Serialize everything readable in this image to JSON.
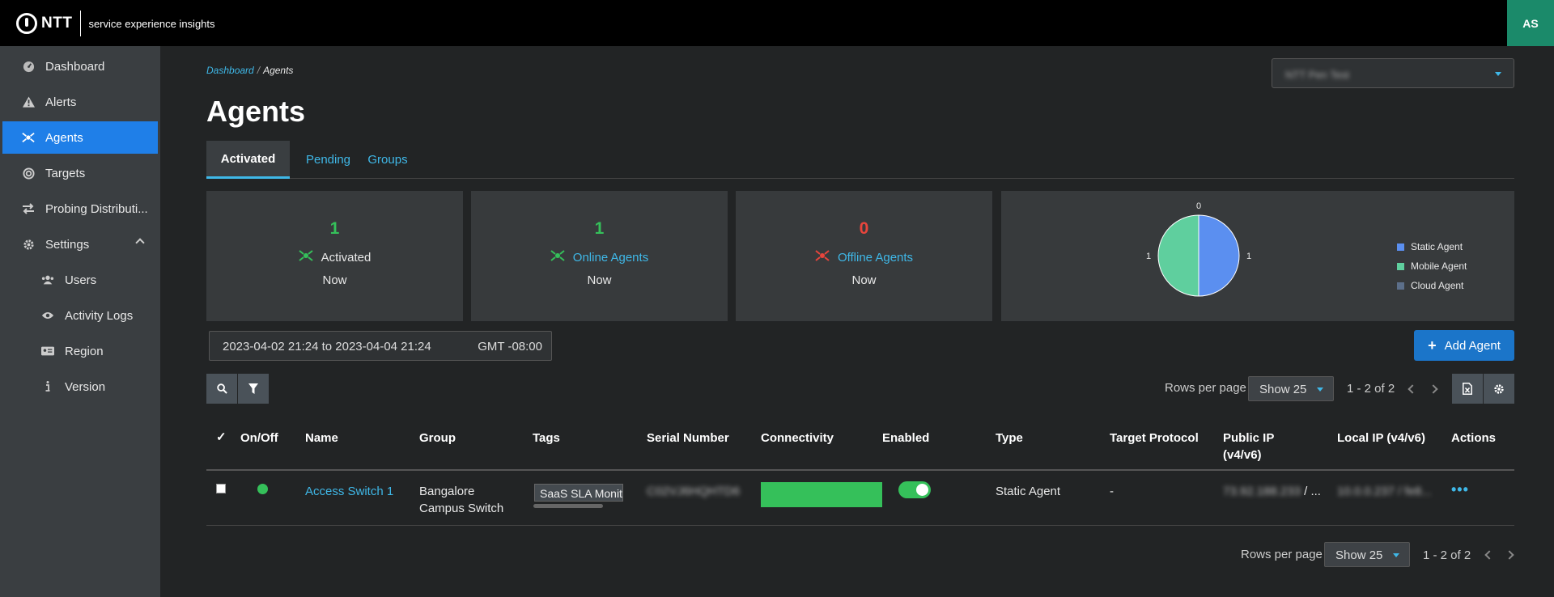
{
  "brand": {
    "name": "NTT",
    "product": "service experience insights"
  },
  "user": {
    "initials": "AS"
  },
  "sidebar": {
    "items": [
      {
        "label": "Dashboard",
        "icon": "dashboard-icon"
      },
      {
        "label": "Alerts",
        "icon": "warning-icon"
      },
      {
        "label": "Agents",
        "icon": "agent-icon"
      },
      {
        "label": "Targets",
        "icon": "target-icon"
      },
      {
        "label": "Probing Distributi...",
        "icon": "transfer-icon"
      },
      {
        "label": "Settings",
        "icon": "gear-icon"
      },
      {
        "label": "Users",
        "icon": "users-icon"
      },
      {
        "label": "Activity Logs",
        "icon": "eye-icon"
      },
      {
        "label": "Region",
        "icon": "id-card-icon"
      },
      {
        "label": "Version",
        "icon": "info-icon"
      }
    ]
  },
  "breadcrumb": {
    "parent": "Dashboard",
    "separator": "/",
    "current": "Agents"
  },
  "page": {
    "title": "Agents"
  },
  "org_select": {
    "value": "NTT Pen Test"
  },
  "tabs": [
    {
      "label": "Activated"
    },
    {
      "label": "Pending"
    },
    {
      "label": "Groups"
    }
  ],
  "summary": {
    "activated": {
      "count": "1",
      "label": "Activated",
      "time": "Now"
    },
    "online": {
      "count": "1",
      "label": "Online Agents",
      "time": "Now"
    },
    "offline": {
      "count": "0",
      "label": "Offline Agents",
      "time": "Now"
    }
  },
  "chart_data": {
    "type": "pie",
    "categories": [
      "Static Agent",
      "Mobile Agent",
      "Cloud Agent"
    ],
    "values": [
      1,
      1,
      0
    ],
    "colors": [
      "#5b8ff0",
      "#5fcf9e",
      "#5c6f8a"
    ],
    "legend_position": "right"
  },
  "filters": {
    "date_range": "2023-04-02 21:24 to 2023-04-04 21:24",
    "timezone": "GMT -08:00"
  },
  "add_agent": {
    "label": "Add Agent"
  },
  "pagination": {
    "rows_label": "Rows per page",
    "rows_value": "Show 25",
    "range": "1 - 2 of 2"
  },
  "table": {
    "columns": [
      "On/Off",
      "Name",
      "Group",
      "Tags",
      "Serial Number",
      "Connectivity",
      "Enabled",
      "Type",
      "Target Protocol",
      "Public IP (v4/v6)",
      "Local IP (v4/v6)",
      "Actions"
    ],
    "rows": [
      {
        "status": "online",
        "name": "Access Switch 1",
        "group_line1": "Bangalore",
        "group_line2": "Campus Switch",
        "tag": "SaaS SLA Monitoring",
        "serial": "C02VJ6HQHTD6",
        "connectivity": 1.0,
        "enabled": true,
        "type": "Static Agent",
        "target_protocol": "-",
        "public_ip": "73.92.188.233",
        "public_ip_suffix": "/ ...",
        "local_ip": "10.0.0.237 / fe8..."
      }
    ]
  },
  "colors": {
    "accent": "#3fb8e8",
    "primary": "#1f7fe8",
    "success": "#35c05a",
    "danger": "#e8453c"
  }
}
